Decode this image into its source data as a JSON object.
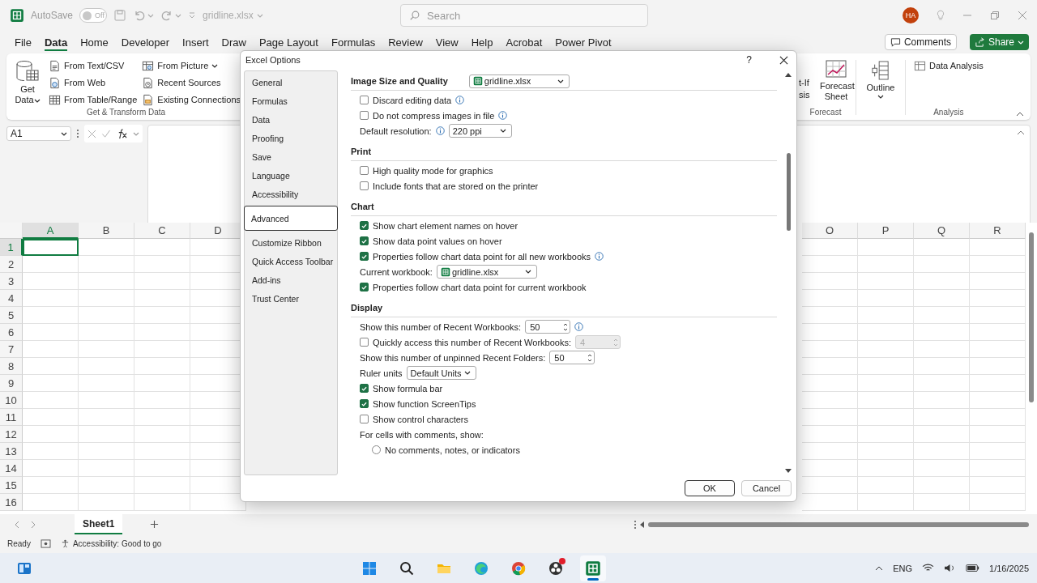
{
  "title_bar": {
    "autosave_label": "AutoSave",
    "autosave_on": false,
    "autosave_state": "Off",
    "file_name": "gridline.xlsx",
    "search_placeholder": "Search",
    "avatar_initials": "HA"
  },
  "ribbon_tabs": [
    {
      "label": "File",
      "selected": false
    },
    {
      "label": "Data",
      "selected": true
    },
    {
      "label": "Home",
      "selected": false
    },
    {
      "label": "Developer",
      "selected": false
    },
    {
      "label": "Insert",
      "selected": false
    },
    {
      "label": "Draw",
      "selected": false
    },
    {
      "label": "Page Layout",
      "selected": false
    },
    {
      "label": "Formulas",
      "selected": false
    },
    {
      "label": "Review",
      "selected": false
    },
    {
      "label": "View",
      "selected": false
    },
    {
      "label": "Help",
      "selected": false
    },
    {
      "label": "Acrobat",
      "selected": false
    },
    {
      "label": "Power Pivot",
      "selected": false
    }
  ],
  "comments_button": "Comments",
  "share_button": "Share",
  "ribbon": {
    "get_data": "Get Data",
    "small_buttons": [
      {
        "label": "From Text/CSV",
        "dropdown": false
      },
      {
        "label": "From Web",
        "dropdown": false
      },
      {
        "label": "From Table/Range",
        "dropdown": false
      },
      {
        "label": "From Picture",
        "dropdown": true
      },
      {
        "label": "Recent Sources",
        "dropdown": false
      },
      {
        "label": "Existing Connections",
        "dropdown": false
      }
    ],
    "get_transform_group": "Get & Transform Data",
    "what_if_line_1": "t-If",
    "what_if_line_2": "sis",
    "forecast_sheet": "Forecast Sheet",
    "forecast_group": "Forecast",
    "outline": "Outline",
    "data_analysis": "Data Analysis",
    "analysis_group": "Analysis"
  },
  "formula_bar": {
    "name_box": "A1"
  },
  "sheet": {
    "columns_left": [
      {
        "label": "A",
        "selected": true
      },
      {
        "label": "B",
        "selected": false
      },
      {
        "label": "C",
        "selected": false
      },
      {
        "label": "D",
        "selected": false
      }
    ],
    "columns_right": [
      {
        "label": "O",
        "selected": false
      },
      {
        "label": "P",
        "selected": false
      },
      {
        "label": "Q",
        "selected": false
      },
      {
        "label": "R",
        "selected": false
      }
    ],
    "rows": [
      {
        "label": "1",
        "selected": true
      },
      {
        "label": "2",
        "selected": false
      },
      {
        "label": "3",
        "selected": false
      },
      {
        "label": "4",
        "selected": false
      },
      {
        "label": "5",
        "selected": false
      },
      {
        "label": "6",
        "selected": false
      },
      {
        "label": "7",
        "selected": false
      },
      {
        "label": "8",
        "selected": false
      },
      {
        "label": "9",
        "selected": false
      },
      {
        "label": "10",
        "selected": false
      },
      {
        "label": "11",
        "selected": false
      },
      {
        "label": "12",
        "selected": false
      },
      {
        "label": "13",
        "selected": false
      },
      {
        "label": "14",
        "selected": false
      },
      {
        "label": "15",
        "selected": false
      },
      {
        "label": "16",
        "selected": false
      }
    ]
  },
  "sheet_tabs": [
    {
      "label": "Sheet1",
      "selected": true
    }
  ],
  "status_bar": {
    "mode": "Ready",
    "accessibility": "Accessibility: Good to go"
  },
  "taskbar": {
    "apps": [
      {
        "kind": "widgets",
        "selected": false,
        "badge": false
      },
      {
        "kind": "start",
        "selected": false,
        "badge": false
      },
      {
        "kind": "search",
        "selected": false,
        "badge": false
      },
      {
        "kind": "explorer",
        "selected": false,
        "badge": false
      },
      {
        "kind": "edge",
        "selected": false,
        "badge": false
      },
      {
        "kind": "chrome",
        "selected": false,
        "badge": false
      },
      {
        "kind": "obs",
        "selected": false,
        "badge": true
      },
      {
        "kind": "excel",
        "selected": true,
        "badge": false
      }
    ],
    "language": "ENG",
    "date": "1/16/2025"
  },
  "dialog": {
    "title": "Excel Options",
    "help": "?",
    "nav": [
      {
        "label": "General",
        "selected": false
      },
      {
        "label": "Formulas",
        "selected": false
      },
      {
        "label": "Data",
        "selected": false
      },
      {
        "label": "Proofing",
        "selected": false
      },
      {
        "label": "Save",
        "selected": false
      },
      {
        "label": "Language",
        "selected": false
      },
      {
        "label": "Accessibility",
        "selected": false
      },
      {
        "label": "Advanced",
        "selected": true
      },
      {
        "label": "Customize Ribbon",
        "selected": false
      },
      {
        "label": "Quick Access Toolbar",
        "selected": false
      },
      {
        "label": "Add-ins",
        "selected": false
      },
      {
        "label": "Trust Center",
        "selected": false
      }
    ],
    "sections": [
      {
        "heading": "Image Size and Quality",
        "file_select": "gridline.xlsx",
        "items": [
          {
            "kind": "checkbox",
            "label": "Discard editing data",
            "checked": false,
            "info": true
          },
          {
            "kind": "checkbox",
            "label": "Do not compress images in file",
            "checked": false,
            "info": true
          },
          {
            "kind": "select",
            "label": "Default resolution:",
            "value": "220 ppi",
            "info": true
          }
        ]
      },
      {
        "heading": "Print",
        "items": [
          {
            "kind": "checkbox",
            "label": "High quality mode for graphics",
            "checked": false,
            "info": false
          },
          {
            "kind": "checkbox",
            "label": "Include fonts that are stored on the printer",
            "checked": false,
            "info": false
          }
        ]
      },
      {
        "heading": "Chart",
        "items": [
          {
            "kind": "checkbox",
            "label": "Show chart element names on hover",
            "checked": true,
            "info": false
          },
          {
            "kind": "checkbox",
            "label": "Show data point values on hover",
            "checked": true,
            "info": false
          },
          {
            "kind": "checkbox",
            "label": "Properties follow chart data point for all new workbooks",
            "checked": true,
            "info": true
          },
          {
            "kind": "file-select",
            "label": "Current workbook:",
            "value": "gridline.xlsx",
            "info": false
          },
          {
            "kind": "checkbox",
            "label": "Properties follow chart data point for current workbook",
            "checked": true,
            "info": false
          }
        ]
      },
      {
        "heading": "Display",
        "items": [
          {
            "kind": "spin",
            "label": "Show this number of Recent Workbooks:",
            "value": "50",
            "info": true,
            "disabled": false
          },
          {
            "kind": "checkbox-spin",
            "label": "Quickly access this number of Recent Workbooks:",
            "checked": false,
            "value": "4",
            "disabled": true
          },
          {
            "kind": "spin",
            "label": "Show this number of unpinned Recent Folders:",
            "value": "50",
            "info": false,
            "disabled": false
          },
          {
            "kind": "select",
            "label": "Ruler units",
            "value": "Default Units",
            "info": false
          },
          {
            "kind": "checkbox",
            "label": "Show formula bar",
            "checked": true,
            "info": false
          },
          {
            "kind": "checkbox",
            "label": "Show function ScreenTips",
            "checked": true,
            "info": false
          },
          {
            "kind": "checkbox",
            "label": "Show control characters",
            "checked": false,
            "info": false
          },
          {
            "kind": "text",
            "label": "For cells with comments, show:"
          },
          {
            "kind": "radio",
            "label": "No comments, notes, or indicators",
            "selected": false
          }
        ]
      }
    ],
    "buttons": [
      {
        "label": "OK",
        "kind": "primary"
      },
      {
        "label": "Cancel",
        "kind": "secondary"
      }
    ]
  }
}
